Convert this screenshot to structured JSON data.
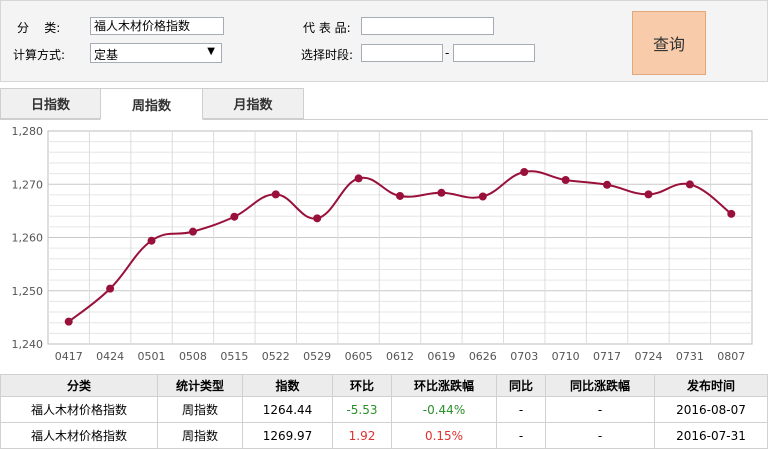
{
  "query": {
    "category_label": "分    类:",
    "category_value": "福人木材价格指数",
    "method_label": "计算方式:",
    "method_value": "定基",
    "rep_label": "代 表 品:",
    "rep_value": "",
    "period_label": "选择时段:",
    "period_start": "",
    "period_sep": "-",
    "period_end": "",
    "search_label": "查询"
  },
  "tabs": [
    {
      "label": "日指数",
      "active": false
    },
    {
      "label": "周指数",
      "active": true
    },
    {
      "label": "月指数",
      "active": false
    }
  ],
  "chart_data": {
    "type": "line",
    "categories": [
      "0417",
      "0424",
      "0501",
      "0508",
      "0515",
      "0522",
      "0529",
      "0605",
      "0612",
      "0619",
      "0626",
      "0703",
      "0710",
      "0717",
      "0724",
      "0731",
      "0807"
    ],
    "values": [
      1244.2,
      1250.4,
      1259.4,
      1261.1,
      1263.9,
      1268.1,
      1263.6,
      1271.1,
      1267.8,
      1268.4,
      1267.7,
      1272.3,
      1270.8,
      1269.9,
      1268.1,
      1269.97,
      1264.44
    ],
    "ylim": [
      1240,
      1280
    ],
    "yticks": [
      "1,240",
      "1,250",
      "1,260",
      "1,270",
      "1,280"
    ],
    "grid": true,
    "line_color": "#99103a"
  },
  "table": {
    "headers": [
      "分类",
      "统计类型",
      "指数",
      "环比",
      "环比涨跌幅",
      "同比",
      "同比涨跌幅",
      "发布时间"
    ],
    "rows": [
      {
        "category": "福人木材价格指数",
        "type": "周指数",
        "index": "1264.44",
        "mom": "-5.53",
        "mom_pct": "-0.44%",
        "yoy": "-",
        "yoy_pct": "-",
        "date": "2016-08-07",
        "trend": "down"
      },
      {
        "category": "福人木材价格指数",
        "type": "周指数",
        "index": "1269.97",
        "mom": "1.92",
        "mom_pct": "0.15%",
        "yoy": "-",
        "yoy_pct": "-",
        "date": "2016-07-31",
        "trend": "up"
      }
    ]
  }
}
